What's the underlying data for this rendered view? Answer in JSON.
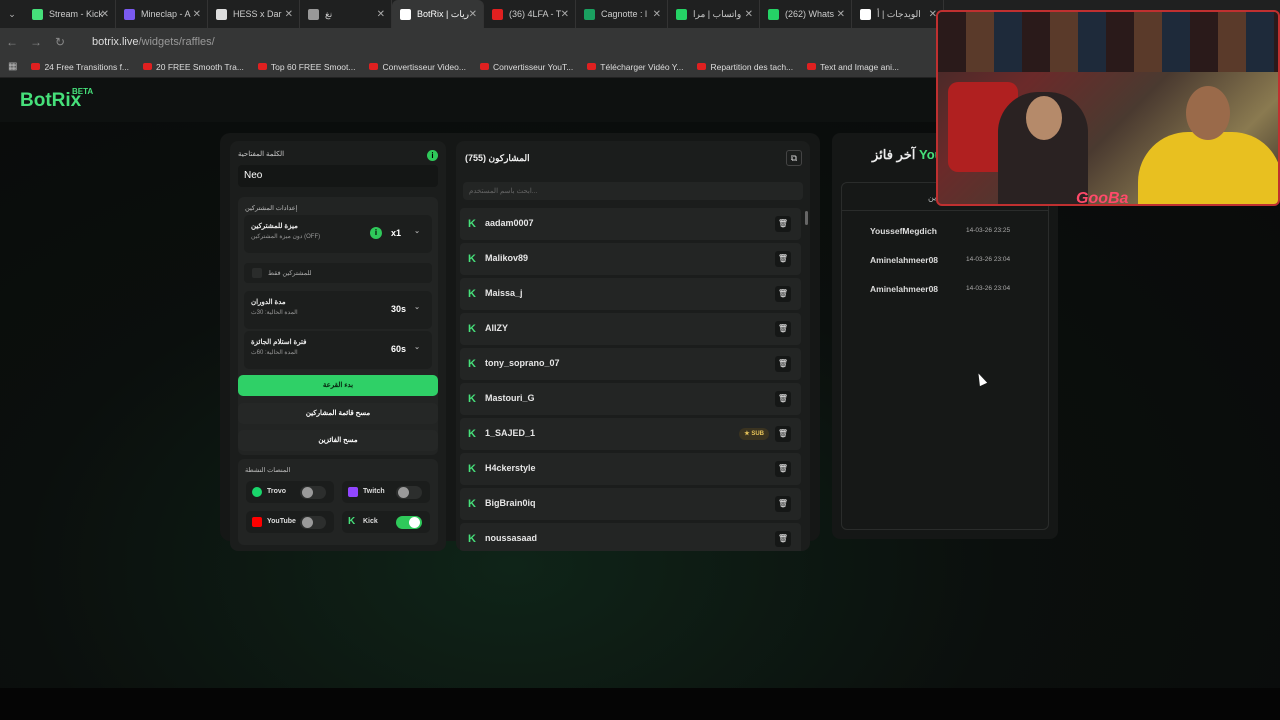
{
  "browser": {
    "tabs": [
      {
        "label": "Stream - Kick",
        "color": "#46e07a"
      },
      {
        "label": "Mineclap - A",
        "color": "#7a5af0"
      },
      {
        "label": "HESS x Dar",
        "color": "#dddddd"
      },
      {
        "label": "نغ",
        "color": "#999999"
      },
      {
        "label": "BotRix | ريات",
        "color": "#ffffff",
        "active": true
      },
      {
        "label": "(36) 4LFA - T",
        "color": "#e02020"
      },
      {
        "label": "Cagnotte : l",
        "color": "#1aa060"
      },
      {
        "label": "واتساب | مرا",
        "color": "#25d366"
      },
      {
        "label": "(262) Whats",
        "color": "#25d366"
      },
      {
        "label": "الويدجات | أ",
        "color": "#ffffff"
      }
    ],
    "url_host": "botrix.live",
    "url_path": "/widgets/raffles/",
    "bookmarks": [
      "24 Free Transitions f...",
      "20 FREE Smooth Tra...",
      "Top 60 FREE Smoot...",
      "Convertisseur Video...",
      "Convertisseur YouT...",
      "Télécharger Vidéo Y...",
      "Repartition des tach...",
      "Text and Image ani..."
    ]
  },
  "app": {
    "logo": "BotRix",
    "logo_badge": "BETA"
  },
  "settings": {
    "keyword_label": "الكلمة المفتاحية",
    "keyword_value": "Neo",
    "participants_settings_title": "إعدادات المشتركين",
    "subscriber_advantage_title": "ميزة للمشتركين",
    "subscriber_advantage_sub": "دون ميزة المشتركين (OFF)",
    "multiplier": "x1",
    "subscribers_only": "للمشتركين فقط",
    "round_duration_title": "مدة الدوران",
    "round_duration_sub": "المدة الحالية: 30ث",
    "round_duration": "30s",
    "claim_period_title": "فترة استلام الجائزة",
    "claim_period_sub": "المدة الحالية: 60ث",
    "claim_period": "60s",
    "start_button": "بدء القرعة",
    "clear_participants_button": "مسح قائمة المشاركين",
    "clear_winners_button": "مسح الفائزين",
    "platforms_title": "المنصات النشطة",
    "platforms": {
      "trovo": "Trovo",
      "twitch": "Twitch",
      "youtube": "YouTube",
      "kick": "Kick"
    }
  },
  "participants": {
    "title": "المشاركون (755)",
    "search_placeholder": "ابحث باسم المستخدم...",
    "sub_badge": "★ SUB",
    "items": [
      {
        "name": "aadam0007"
      },
      {
        "name": "Malikov89"
      },
      {
        "name": "Maissa_j"
      },
      {
        "name": "AllZY"
      },
      {
        "name": "tony_soprano_07"
      },
      {
        "name": "Mastouri_G"
      },
      {
        "name": "1_SAJED_1"
      },
      {
        "name": "H4ckerstyle"
      },
      {
        "name": "BigBrain0iq"
      },
      {
        "name": "noussasaad"
      }
    ]
  },
  "winners": {
    "title_prefix": "آخر فائز",
    "title_name": "You",
    "list_header": "ين",
    "items": [
      {
        "name": "YoussefMegdich",
        "date": "14-03-26 23:25"
      },
      {
        "name": "Aminelahmeer08",
        "date": "14-03-26 23:04"
      },
      {
        "name": "Aminelahmeer08",
        "date": "14-03-26 23:04"
      }
    ]
  },
  "webcam": {
    "overlay_text": "GooBa"
  },
  "colors": {
    "accent": "#2fd067",
    "kick": "#46e07a",
    "twitch": "#9146ff",
    "youtube": "#ff0000",
    "trovo": "#19d66b"
  }
}
